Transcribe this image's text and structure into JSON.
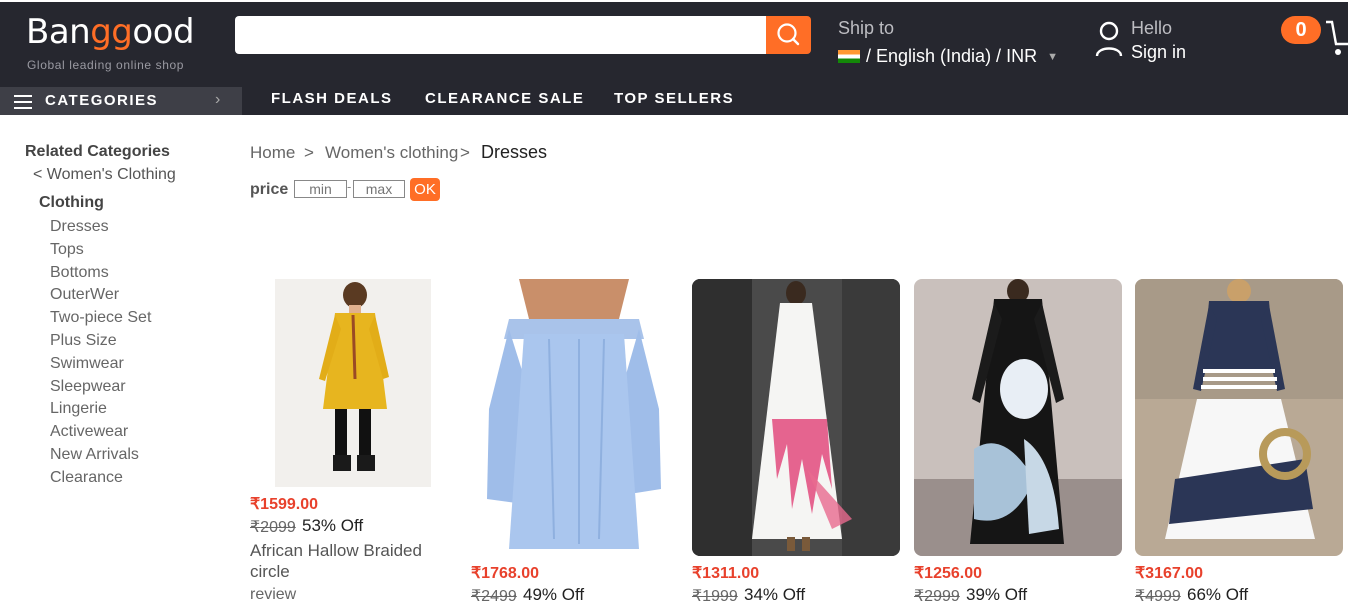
{
  "header": {
    "logo_pre": "Ban",
    "logo_gg": "gg",
    "logo_post": "ood",
    "tagline": "Global leading online shop",
    "search_placeholder": "",
    "ship_to": "Ship to",
    "lang_currency": "/ English (India) / INR",
    "hello": "Hello",
    "sign_in": "Sign in",
    "cart_count": "0",
    "accent_color": "#ff6e26"
  },
  "nav": {
    "categories": "CATEGORIES",
    "items": [
      "FLASH DEALS",
      "CLEARANCE SALE",
      "TOP SELLERS"
    ]
  },
  "sidebar": {
    "title": "Related Categories",
    "back": "< Women's Clothing",
    "section": "Clothing",
    "items": [
      "Dresses",
      "Tops",
      "Bottoms",
      "OuterWer",
      "Two-piece Set",
      "Plus Size",
      "Swimwear",
      "Sleepwear",
      "Lingerie",
      "Activewear",
      "New Arrivals",
      "Clearance"
    ]
  },
  "breadcrumb": {
    "home": "Home",
    "sep": ">",
    "parent": "Women's clothing",
    "current": "Dresses"
  },
  "filter": {
    "label": "price",
    "min_placeholder": "min",
    "dash": "-",
    "max_placeholder": "max",
    "ok": "OK"
  },
  "products": [
    {
      "price": "₹1599.00",
      "old": "₹2099",
      "off": "53% Off",
      "name1": "African Hallow Braided",
      "name2": "circle",
      "review": "review"
    },
    {
      "price": "₹1768.00",
      "old": "₹2499",
      "off": "49% Off"
    },
    {
      "price": "₹1311.00",
      "old": "₹1999",
      "off": "34% Off"
    },
    {
      "price": "₹1256.00",
      "old": "₹2999",
      "off": "39% Off"
    },
    {
      "price": "₹3167.00",
      "old": "₹4999",
      "off": "66% Off"
    }
  ]
}
